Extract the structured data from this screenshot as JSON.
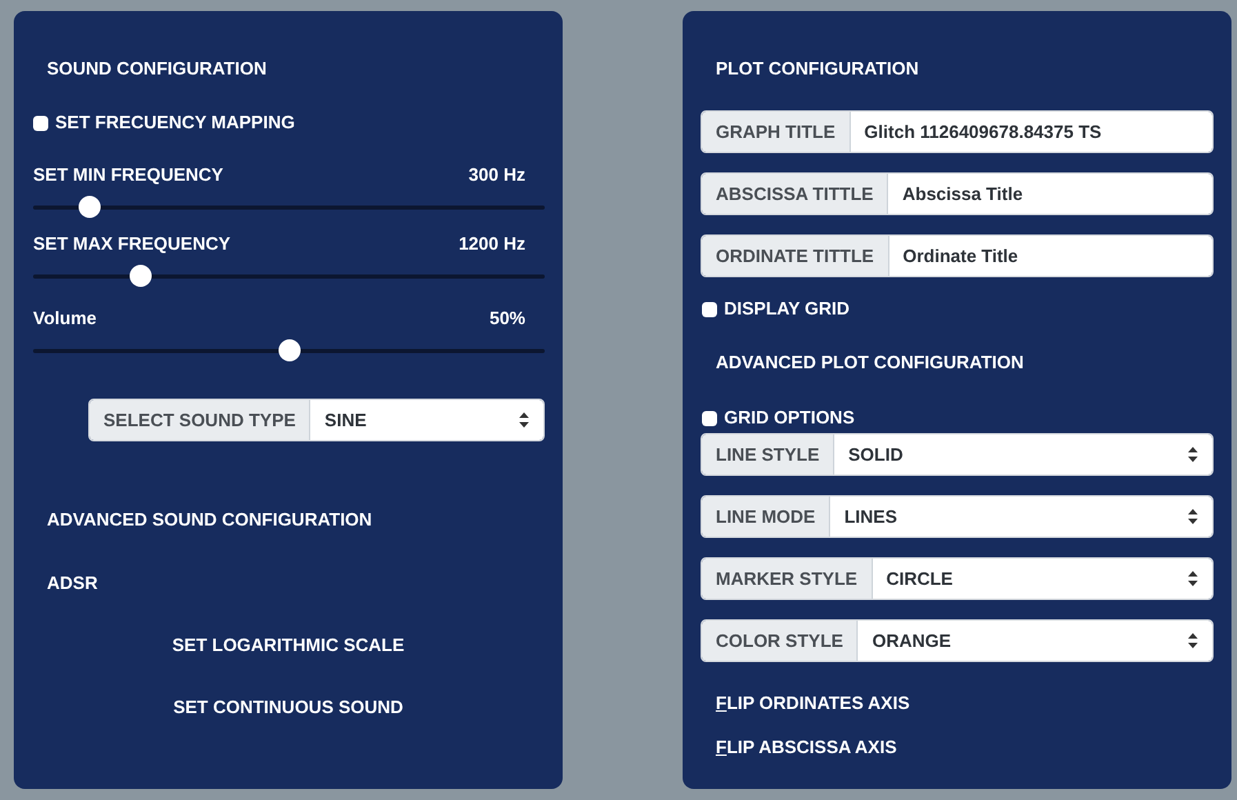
{
  "sound_panel": {
    "title": "SOUND CONFIGURATION",
    "frequency_mapping": {
      "label": "SET FRECUENCY MAPPING",
      "checked": false
    },
    "sliders": [
      {
        "label": "SET MIN FREQUENCY",
        "reading": "300 Hz",
        "level": 0.11
      },
      {
        "label": "SET MAX FREQUENCY",
        "reading": "1200 Hz",
        "level": 0.21
      },
      {
        "label": "Volume",
        "reading": "50%",
        "level": 0.5
      }
    ],
    "sound_type": {
      "label": "SELECT SOUND TYPE",
      "value": "SINE"
    },
    "advanced_title": "ADVANCED SOUND CONFIGURATION",
    "adsr": "ADSR",
    "toggles": [
      "SET LOGARITHMIC SCALE",
      "SET CONTINUOUS SOUND"
    ]
  },
  "plot_panel": {
    "title": "PLOT CONFIGURATION",
    "inputs": [
      {
        "label": "GRAPH TITLE",
        "value": "Glitch 1126409678.84375 TS"
      },
      {
        "label": "ABSCISSA TITTLE",
        "value": "Abscissa Title"
      },
      {
        "label": "ORDINATE TITTLE",
        "value": "Ordinate Title"
      }
    ],
    "display_grid": {
      "label": "DISPLAY GRID",
      "checked": false
    },
    "advanced_title": "ADVANCED PLOT CONFIGURATION",
    "grid_options": {
      "label": "GRID OPTIONS",
      "checked": false
    },
    "selects": [
      {
        "label": "LINE STYLE",
        "value": "SOLID"
      },
      {
        "label": "LINE MODE",
        "value": "LINES"
      },
      {
        "label": "MARKER STYLE",
        "value": "CIRCLE"
      },
      {
        "label": "COLOR STYLE",
        "value": "ORANGE"
      }
    ],
    "flip_buttons": [
      {
        "label": "FLIP ORDINATES AXIS",
        "access_key_underlined": true
      },
      {
        "label": "FLIP ABSCISSA AXIS",
        "access_key_underlined": true
      }
    ]
  }
}
